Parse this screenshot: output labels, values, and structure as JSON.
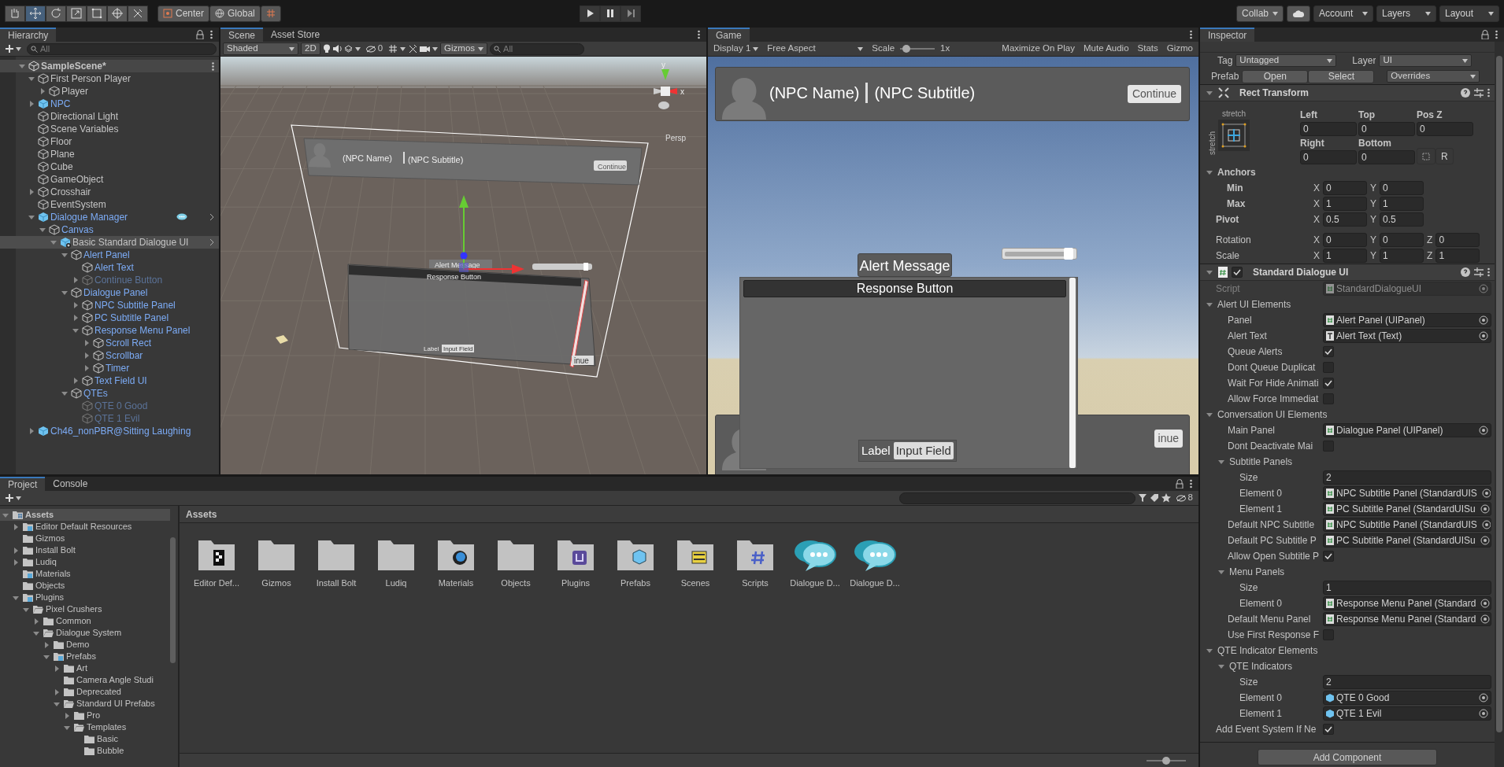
{
  "toolbar": {
    "tools": [
      {
        "kind": "hand",
        "selected": false
      },
      {
        "kind": "move",
        "selected": true
      },
      {
        "kind": "rotate",
        "selected": false
      },
      {
        "kind": "scale",
        "selected": false
      },
      {
        "kind": "rect",
        "selected": false
      },
      {
        "kind": "transform",
        "selected": false
      },
      {
        "kind": "custom",
        "selected": false
      }
    ],
    "pivot": "Center",
    "space": "Global",
    "right": [
      "Collab",
      "Account",
      "Layers",
      "Layout"
    ]
  },
  "hierarchy": {
    "tabs": [
      {
        "label": "Hierarchy",
        "selected": true
      }
    ],
    "search_placeholder": "All",
    "scene": "SampleScene*",
    "items": [
      {
        "label": "First Person Player",
        "kind": "object",
        "selected": false,
        "expanded": true,
        "children": [
          {
            "label": "Player",
            "kind": "object",
            "selected": false,
            "expanded": false
          }
        ]
      },
      {
        "label": "NPC",
        "kind": "prefab",
        "selected": false,
        "expanded": false
      },
      {
        "label": "Directional Light",
        "kind": "object",
        "selected": false
      },
      {
        "label": "Scene Variables",
        "kind": "object",
        "selected": false
      },
      {
        "label": "Floor",
        "kind": "object",
        "selected": false
      },
      {
        "label": "Plane",
        "kind": "object",
        "selected": false
      },
      {
        "label": "Cube",
        "kind": "object",
        "selected": false
      },
      {
        "label": "GameObject",
        "kind": "object",
        "selected": false
      },
      {
        "label": "Crosshair",
        "kind": "object",
        "selected": false,
        "expanded": false
      },
      {
        "label": "EventSystem",
        "kind": "object",
        "selected": false
      },
      {
        "label": "Dialogue Manager",
        "kind": "prefab",
        "selected": false,
        "expanded": true,
        "chat_icon": true,
        "open_arrow": true,
        "children": [
          {
            "label": "Canvas",
            "kind": "prefab_part",
            "selected": false,
            "expanded": true,
            "children": [
              {
                "label": "Basic Standard Dialogue UI",
                "kind": "nested_prefab",
                "selected": true,
                "expanded": true,
                "open_arrow": true,
                "children": [
                  {
                    "label": "Alert Panel",
                    "kind": "prefab_part",
                    "selected": false,
                    "expanded": true,
                    "children": [
                      {
                        "label": "Alert Text",
                        "kind": "prefab_part",
                        "selected": false
                      },
                      {
                        "label": "Continue Button",
                        "kind": "prefab_part",
                        "inactive": true,
                        "selected": false,
                        "expanded": false
                      }
                    ]
                  },
                  {
                    "label": "Dialogue Panel",
                    "kind": "prefab_part",
                    "selected": false,
                    "expanded": true,
                    "children": [
                      {
                        "label": "NPC Subtitle Panel",
                        "kind": "prefab_part",
                        "selected": false,
                        "expanded": false
                      },
                      {
                        "label": "PC Subtitle Panel",
                        "kind": "prefab_part",
                        "selected": false,
                        "expanded": false
                      },
                      {
                        "label": "Response Menu Panel",
                        "kind": "prefab_part",
                        "selected": false,
                        "expanded": true,
                        "children": [
                          {
                            "label": "Scroll Rect",
                            "kind": "prefab_part",
                            "selected": false,
                            "expanded": false
                          },
                          {
                            "label": "Scrollbar",
                            "kind": "prefab_part",
                            "selected": false,
                            "expanded": false
                          },
                          {
                            "label": "Timer",
                            "kind": "prefab_part",
                            "selected": false,
                            "expanded": false
                          }
                        ]
                      },
                      {
                        "label": "Text Field UI",
                        "kind": "prefab_part",
                        "selected": false,
                        "expanded": false
                      }
                    ]
                  },
                  {
                    "label": "QTEs",
                    "kind": "prefab_part",
                    "selected": false,
                    "expanded": true,
                    "children": [
                      {
                        "label": "QTE 0 Good",
                        "kind": "prefab_part",
                        "inactive": true,
                        "selected": false
                      },
                      {
                        "label": "QTE 1 Evil",
                        "kind": "prefab_part",
                        "inactive": true,
                        "selected": false
                      }
                    ]
                  }
                ]
              }
            ]
          }
        ]
      },
      {
        "label": "Ch46_nonPBR@Sitting Laughing",
        "kind": "prefab",
        "selected": false,
        "expanded": false
      }
    ]
  },
  "scene": {
    "tabs": [
      {
        "label": "Scene",
        "selected": true
      },
      {
        "label": "Asset Store",
        "selected": false
      }
    ],
    "shading": "Shaded",
    "mode_2d": "2D",
    "hidden_count": "0",
    "gizmos": "Gizmos",
    "search_placeholder": "All",
    "view": {
      "npc_name": "(NPC Name)",
      "npc_subtitle": "(NPC Subtitle)",
      "continue": "Continue",
      "alert": "Alert Message",
      "timer": {
        "level": 0.93
      },
      "response": "Response Button",
      "label": "Label",
      "input": "Input Field",
      "pc_continue": "inue",
      "projection": "Persp",
      "axis_y": "y",
      "axis_x": "x"
    }
  },
  "game": {
    "tabs": [
      {
        "label": "Game",
        "selected": true
      }
    ],
    "display": "Display 1",
    "aspect": "Free Aspect",
    "scale_label": "Scale",
    "scale_slider": {
      "level": 0.1
    },
    "scale_value": "1x",
    "toggles": [
      "Maximize On Play",
      "Mute Audio",
      "Stats",
      "Gizmo"
    ],
    "view": {
      "npc_name": "(NPC Name)",
      "npc_subtitle": "(NPC Subtitle)",
      "continue": "Continue",
      "alert": "Alert Message",
      "timer": {
        "level": 0.93
      },
      "response": "Response Button",
      "label": "Label",
      "input": "Input Field",
      "pc_continue": "inue"
    }
  },
  "inspector": {
    "tabs": [
      {
        "label": "Inspector",
        "selected": true
      }
    ],
    "tag_label": "Tag",
    "tag": "Untagged",
    "layer_label": "Layer",
    "layer": "UI",
    "prefab_label": "Prefab",
    "prefab_buttons": [
      "Open",
      "Select"
    ],
    "overrides": "Overrides",
    "rect_transform": {
      "title": "Rect Transform",
      "expanded": true,
      "anchor_h": "stretch",
      "anchor_v": "stretch",
      "offsets": [
        {
          "label": "Left",
          "value": "0"
        },
        {
          "label": "Top",
          "value": "0"
        },
        {
          "label": "Pos Z",
          "value": "0"
        },
        {
          "label": "Right",
          "value": "0"
        },
        {
          "label": "Bottom",
          "value": "0"
        }
      ],
      "raw_button": "R",
      "anchors_label": "Anchors",
      "anchors_expanded": true,
      "rows": [
        {
          "label": "Min",
          "sub": true,
          "values": [
            {
              "axis": "X",
              "value": "0"
            },
            {
              "axis": "Y",
              "value": "0"
            }
          ]
        },
        {
          "label": "Max",
          "sub": true,
          "values": [
            {
              "axis": "X",
              "value": "1"
            },
            {
              "axis": "Y",
              "value": "1"
            }
          ]
        },
        {
          "label": "Pivot",
          "sub": false,
          "values": [
            {
              "axis": "X",
              "value": "0.5"
            },
            {
              "axis": "Y",
              "value": "0.5"
            }
          ]
        },
        {
          "label": "Rotation",
          "sub": false,
          "values": [
            {
              "axis": "X",
              "value": "0"
            },
            {
              "axis": "Y",
              "value": "0"
            },
            {
              "axis": "Z",
              "value": "0"
            }
          ]
        },
        {
          "label": "Scale",
          "sub": false,
          "values": [
            {
              "axis": "X",
              "value": "1"
            },
            {
              "axis": "Y",
              "value": "1"
            },
            {
              "axis": "Z",
              "value": "1"
            }
          ]
        }
      ]
    },
    "component": {
      "title": "Standard Dialogue UI",
      "enabled": true,
      "expanded": true,
      "fields": [
        {
          "kind": "script",
          "label": "Script",
          "value": "StandardDialogueUI",
          "disabled": true
        },
        {
          "kind": "foldout",
          "label": "Alert UI Elements",
          "expanded": true,
          "children": [
            {
              "kind": "script_ref",
              "label": "Panel",
              "value": "Alert Panel (UIPanel)"
            },
            {
              "kind": "text_ref",
              "label": "Alert Text",
              "value": "Alert Text (Text)"
            },
            {
              "kind": "toggle",
              "label": "Queue Alerts",
              "checked": true
            },
            {
              "kind": "toggle",
              "label": "Dont Queue Duplicat",
              "checked": false
            },
            {
              "kind": "toggle",
              "label": "Wait For Hide Animati",
              "checked": true
            },
            {
              "kind": "toggle",
              "label": "Allow Force Immediat",
              "checked": false
            }
          ]
        },
        {
          "kind": "foldout",
          "label": "Conversation UI Elements",
          "expanded": true,
          "children": [
            {
              "kind": "script_ref",
              "label": "Main Panel",
              "value": "Dialogue Panel (UIPanel)"
            },
            {
              "kind": "toggle",
              "label": "Dont Deactivate Mai",
              "checked": false
            },
            {
              "kind": "foldout",
              "label": "Subtitle Panels",
              "expanded": true,
              "children": [
                {
                  "kind": "number",
                  "label": "Size",
                  "value": "2"
                },
                {
                  "kind": "script_ref",
                  "label": "Element 0",
                  "value": "NPC Subtitle Panel (StandardUIS"
                },
                {
                  "kind": "script_ref",
                  "label": "Element 1",
                  "value": "PC Subtitle Panel (StandardUISu"
                }
              ]
            },
            {
              "kind": "script_ref",
              "label": "Default NPC Subtitle",
              "value": "NPC Subtitle Panel (StandardUIS"
            },
            {
              "kind": "script_ref",
              "label": "Default PC Subtitle P",
              "value": "PC Subtitle Panel (StandardUISu"
            },
            {
              "kind": "toggle",
              "label": "Allow Open Subtitle P",
              "checked": true
            },
            {
              "kind": "foldout",
              "label": "Menu Panels",
              "expanded": true,
              "children": [
                {
                  "kind": "number",
                  "label": "Size",
                  "value": "1"
                },
                {
                  "kind": "script_ref",
                  "label": "Element 0",
                  "value": "Response Menu Panel (Standard"
                }
              ]
            },
            {
              "kind": "script_ref",
              "label": "Default Menu Panel",
              "value": "Response Menu Panel (Standard"
            },
            {
              "kind": "toggle",
              "label": "Use First Response F",
              "checked": false
            }
          ]
        },
        {
          "kind": "foldout",
          "label": "QTE Indicator Elements",
          "expanded": true,
          "children": [
            {
              "kind": "foldout",
              "label": "QTE Indicators",
              "expanded": true,
              "children": [
                {
                  "kind": "number",
                  "label": "Size",
                  "value": "2"
                },
                {
                  "kind": "prefab_ref",
                  "label": "Element 0",
                  "value": "QTE 0 Good"
                },
                {
                  "kind": "prefab_ref",
                  "label": "Element 1",
                  "value": "QTE 1 Evil"
                }
              ]
            }
          ]
        },
        {
          "kind": "toggle",
          "label": "Add Event System If Ne",
          "checked": true
        }
      ]
    },
    "add_component": "Add Component"
  },
  "project": {
    "tabs": [
      {
        "label": "Project",
        "selected": true
      },
      {
        "label": "Console",
        "selected": false
      }
    ],
    "hidden_count": "8",
    "breadcrumb": "Assets",
    "tree": [
      {
        "label": "Assets",
        "kind": "assets",
        "selected": true,
        "expanded": true,
        "children": [
          {
            "label": "Editor Default Resources",
            "kind": "special",
            "selected": false,
            "expanded": false
          },
          {
            "label": "Gizmos",
            "kind": "folder",
            "selected": false
          },
          {
            "label": "Install Bolt",
            "kind": "folder",
            "selected": false,
            "expanded": false
          },
          {
            "label": "Ludiq",
            "kind": "folder",
            "selected": false,
            "expanded": false
          },
          {
            "label": "Materials",
            "kind": "special",
            "selected": false
          },
          {
            "label": "Objects",
            "kind": "folder",
            "selected": false
          },
          {
            "label": "Plugins",
            "kind": "special",
            "selected": false,
            "expanded": true,
            "children": [
              {
                "label": "Pixel Crushers",
                "kind": "folder",
                "selected": false,
                "expanded": true,
                "children": [
                  {
                    "label": "Common",
                    "kind": "folder",
                    "selected": false,
                    "expanded": false
                  },
                  {
                    "label": "Dialogue System",
                    "kind": "folder",
                    "selected": false,
                    "expanded": true,
                    "children": [
                      {
                        "label": "Demo",
                        "kind": "folder",
                        "selected": false,
                        "expanded": false
                      },
                      {
                        "label": "Prefabs",
                        "kind": "special",
                        "selected": false,
                        "expanded": true,
                        "children": [
                          {
                            "label": "Art",
                            "kind": "folder",
                            "selected": false,
                            "expanded": false
                          },
                          {
                            "label": "Camera Angle Studi",
                            "kind": "folder",
                            "selected": false
                          },
                          {
                            "label": "Deprecated",
                            "kind": "folder",
                            "selected": false,
                            "expanded": false
                          },
                          {
                            "label": "Standard UI Prefabs",
                            "kind": "folder",
                            "selected": false,
                            "expanded": true,
                            "children": [
                              {
                                "label": "Pro",
                                "kind": "folder",
                                "selected": false,
                                "expanded": false
                              },
                              {
                                "label": "Templates",
                                "kind": "folder",
                                "selected": false,
                                "expanded": true,
                                "children": [
                                  {
                                    "label": "Basic",
                                    "kind": "folder",
                                    "selected": false
                                  },
                                  {
                                    "label": "Bubble",
                                    "kind": "folder",
                                    "selected": false
                                  }
                                ]
                              }
                            ]
                          }
                        ]
                      }
                    ]
                  }
                ]
              }
            ]
          }
        ]
      }
    ],
    "assets": [
      {
        "label": "Editor Def...",
        "kind": "editor"
      },
      {
        "label": "Gizmos",
        "kind": "folder"
      },
      {
        "label": "Install Bolt",
        "kind": "folder"
      },
      {
        "label": "Ludiq",
        "kind": "folder"
      },
      {
        "label": "Materials",
        "kind": "materials"
      },
      {
        "label": "Objects",
        "kind": "folder"
      },
      {
        "label": "Plugins",
        "kind": "plugins"
      },
      {
        "label": "Prefabs",
        "kind": "prefabs"
      },
      {
        "label": "Scenes",
        "kind": "scenes"
      },
      {
        "label": "Scripts",
        "kind": "scripts"
      },
      {
        "label": "Dialogue D...",
        "kind": "dialogue"
      },
      {
        "label": "Dialogue D...",
        "kind": "dialogue"
      }
    ],
    "zoom_slider": {
      "level": 0.5
    }
  }
}
